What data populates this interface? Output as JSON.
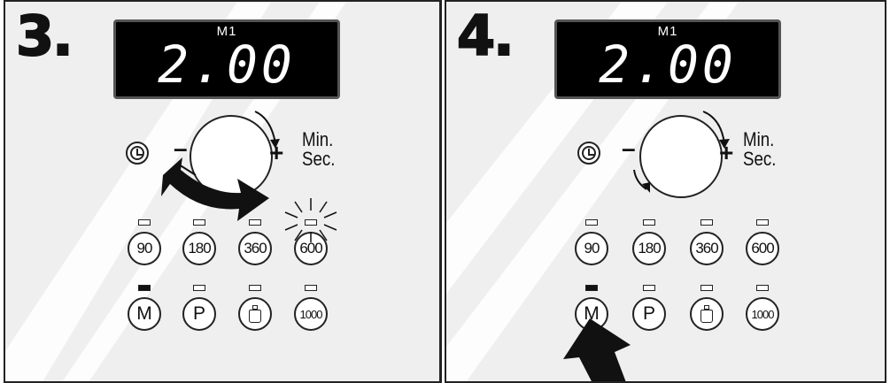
{
  "panels": [
    {
      "step": "3.",
      "display": {
        "mode": "M1",
        "time": "2.00"
      },
      "dial": {
        "minus": "–",
        "plus": "+",
        "unit_min": "Min.",
        "unit_sec": "Sec."
      },
      "power_buttons": [
        "90",
        "180",
        "360",
        "600"
      ],
      "function_buttons": [
        "M",
        "P",
        "",
        "1000"
      ],
      "active_indicator": "M",
      "blinking_indicator": "600",
      "annotation": "curved arrow turning dial"
    },
    {
      "step": "4.",
      "display": {
        "mode": "M1",
        "time": "2.00"
      },
      "dial": {
        "minus": "–",
        "plus": "+",
        "unit_min": "Min.",
        "unit_sec": "Sec."
      },
      "power_buttons": [
        "90",
        "180",
        "360",
        "600"
      ],
      "function_buttons": [
        "M",
        "P",
        "",
        "1000"
      ],
      "active_indicator": "M",
      "annotation": "arrow pointing to M button"
    }
  ],
  "icons": [
    "clock-icon",
    "weight-icon"
  ],
  "colors": {
    "panel_bg": "#efefef",
    "ink": "#111111",
    "display_bg": "#000000"
  }
}
